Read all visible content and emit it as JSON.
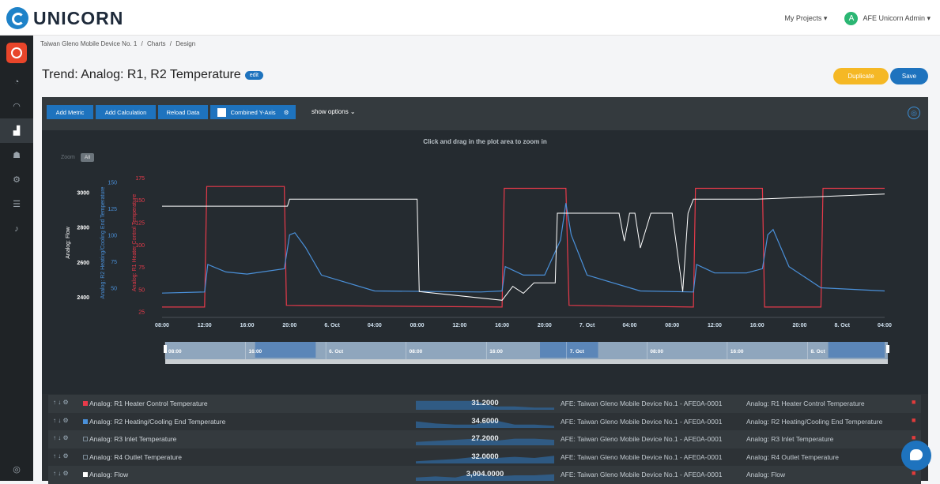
{
  "app": {
    "brand": "UNICORN",
    "my_projects": "My Projects ▾",
    "user_initial": "A",
    "user_name": "AFE Unicorn Admin ▾"
  },
  "breadcrumb": {
    "home": "Taiwan Gleno Mobile Device No. 1",
    "sep1": "/",
    "charts": "Charts",
    "sep2": "/",
    "design": "Design"
  },
  "page": {
    "title": "Trend: Analog: R1, R2 Temperature",
    "edit": "edit",
    "duplicate": "Duplicate",
    "save": "Save"
  },
  "toolbar": {
    "add_metric": "Add Metric",
    "add_calc": "Add Calculation",
    "reload": "Reload Data",
    "combined": "Combined Y-Axis",
    "show_options": "show options"
  },
  "chart": {
    "hint": "Click and drag in the plot area to zoom in",
    "zoom": "Zoom",
    "zoom_all": "All"
  },
  "colors": {
    "r1": "#e83a4a",
    "r2": "#4a90d9",
    "flow": "#ffffff",
    "accent": "#1e73be",
    "dup": "#f5b825"
  },
  "chart_data": {
    "type": "line",
    "x_ticks": [
      "08:00",
      "12:00",
      "16:00",
      "20:00",
      "6. Oct",
      "04:00",
      "08:00",
      "12:00",
      "16:00",
      "20:00",
      "7. Oct",
      "04:00",
      "08:00",
      "12:00",
      "16:00",
      "20:00",
      "8. Oct",
      "04:00"
    ],
    "navigator_ticks": [
      "08:00",
      "16:00",
      "6. Oct",
      "08:00",
      "16:00",
      "7. Oct",
      "08:00",
      "16:00",
      "8. Oct"
    ],
    "axes": [
      {
        "label": "Analog: Flow",
        "ticks": [
          2400,
          2600,
          2800,
          3000
        ],
        "color": "#ffffff"
      },
      {
        "label": "Analog: R2 Heating/Cooling End Temperature",
        "ticks": [
          50,
          75,
          100,
          125,
          150
        ],
        "color": "#4a90d9"
      },
      {
        "label": "Analog: R1 Heater Control Temperature",
        "ticks": [
          25,
          50,
          75,
          100,
          125,
          150,
          175
        ],
        "color": "#e83a4a"
      }
    ],
    "series": [
      {
        "name": "Analog: R1 Heater Control Temperature",
        "axis": 2,
        "x": [
          0,
          4,
          4.2,
          11.5,
          11.7,
          32,
          32.2,
          38,
          38.3,
          50,
          50.2,
          56.5,
          56.7,
          62,
          62.2,
          68
        ],
        "y": [
          30,
          30,
          165,
          165,
          32,
          30,
          163,
          163,
          32,
          30,
          163,
          163,
          30,
          30,
          163,
          163
        ]
      },
      {
        "name": "Analog: R2 Heating/Cooling End Temperature",
        "axis": 1,
        "x": [
          0,
          4,
          4.3,
          6,
          8,
          11.5,
          12,
          12.5,
          13.5,
          15,
          20,
          30,
          32,
          32.3,
          34,
          36,
          37.5,
          38,
          38.5,
          40,
          45,
          50,
          50.3,
          52,
          55,
          56.5,
          57,
          57.5,
          59,
          62,
          68
        ],
        "y": [
          45,
          46,
          72,
          65,
          63,
          68,
          100,
          102,
          88,
          62,
          47,
          46,
          47,
          70,
          62,
          62,
          95,
          130,
          100,
          62,
          47,
          46,
          72,
          64,
          64,
          68,
          100,
          105,
          70,
          50,
          47
        ]
      },
      {
        "name": "Analog: Flow",
        "axis": 0,
        "x": [
          0,
          11.8,
          12,
          24,
          24.2,
          32,
          33,
          34,
          35,
          37,
          37.2,
          43,
          43.5,
          44,
          44.5,
          45,
          46,
          48,
          49,
          49.5,
          50,
          56,
          68
        ],
        "y": [
          2920,
          2920,
          2960,
          2960,
          2430,
          2380,
          2460,
          2420,
          2480,
          2480,
          2880,
          2880,
          2720,
          2880,
          2880,
          2680,
          2880,
          2880,
          2430,
          2880,
          2960,
          2960,
          2990
        ]
      }
    ]
  },
  "rows": [
    {
      "name": "Analog: R1 Heater Control Temperature",
      "value": "31.2000",
      "device": "AFE: Taiwan Gleno Mobile Device No.1 - AFE0A-0001",
      "metric": "Analog: R1 Heater Control Temperature",
      "color": "#e83a4a",
      "spark": [
        0.8,
        0.8,
        0.8,
        0.8,
        0.3,
        0.3,
        0.2,
        0.2
      ]
    },
    {
      "name": "Analog: R2 Heating/Cooling End Temperature",
      "value": "34.6000",
      "device": "AFE: Taiwan Gleno Mobile Device No.1 - AFE0A-0001",
      "metric": "Analog: R2 Heating/Cooling End Temperature",
      "color": "#4a90d9",
      "spark": [
        0.6,
        0.4,
        0.3,
        0.3,
        0.7,
        0.3,
        0.3,
        0.2
      ]
    },
    {
      "name": "Analog: R3 Inlet Temperature",
      "value": "27.2000",
      "device": "AFE: Taiwan Gleno Mobile Device No.1 - AFE0A-0001",
      "metric": "Analog: R3 Inlet Temperature",
      "color": "",
      "spark": [
        0.3,
        0.4,
        0.5,
        0.6,
        0.4,
        0.6,
        0.6,
        0.5
      ]
    },
    {
      "name": "Analog: R4 Outlet Temperature",
      "value": "32.0000",
      "device": "AFE: Taiwan Gleno Mobile Device No.1 - AFE0A-0001",
      "metric": "Analog: R4 Outlet Temperature",
      "color": "",
      "spark": [
        0.2,
        0.3,
        0.4,
        0.6,
        0.5,
        0.6,
        0.5,
        0.7
      ]
    },
    {
      "name": "Analog: Flow",
      "value": "3,004.0000",
      "device": "AFE: Taiwan Gleno Mobile Device No.1 - AFE0A-0001",
      "metric": "Analog: Flow",
      "color": "#ffffff",
      "spark": [
        0.3,
        0.4,
        0.3,
        0.7,
        0.4,
        0.5,
        0.5,
        0.6
      ]
    }
  ]
}
